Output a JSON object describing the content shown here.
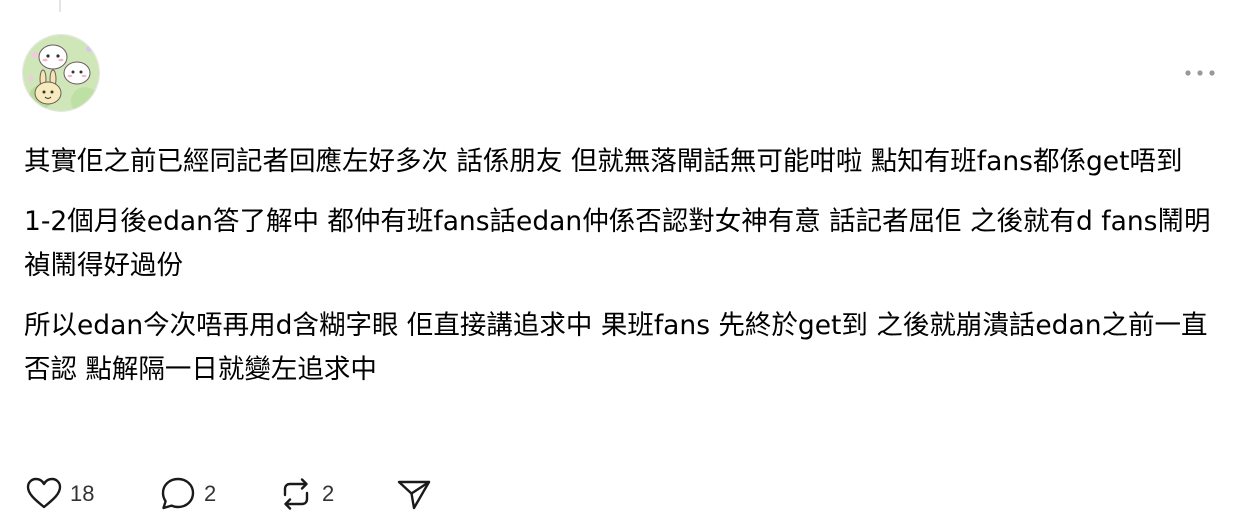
{
  "post": {
    "paragraphs": [
      "其實佢之前已經同記者回應左好多次 話係朋友 但就無落閘話無可能咁啦 點知有班fans都係get唔到",
      "1-2個月後edan答了解中 都仲有班fans話edan仲係否認對女神有意 話記者屈佢 之後就有d fans鬧明禎鬧得好過份",
      "所以edan今次唔再用d含糊字眼 佢直接講追求中 果班fans 先終於get到 之後就崩潰話edan之前一直否認 點解隔一日就變左追求中"
    ]
  },
  "actions": {
    "like_count": "18",
    "reply_count": "2",
    "repost_count": "2"
  },
  "icons": {
    "avatar": "avatar-cartoon-image",
    "more": "more-dots-icon",
    "like": "heart-icon",
    "reply": "comment-bubble-icon",
    "repost": "repost-icon",
    "share": "share-send-icon"
  },
  "colors": {
    "text": "#000000",
    "secondary": "#333333",
    "icon": "#1a1a1a",
    "muted_icon": "#999999"
  }
}
